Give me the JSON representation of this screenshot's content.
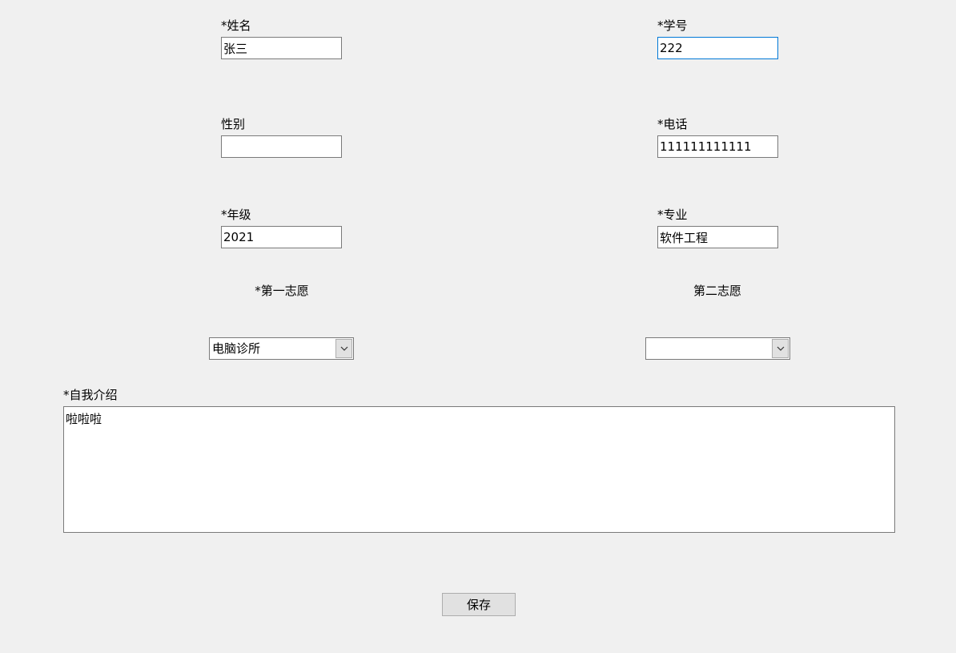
{
  "form": {
    "name": {
      "label": "*姓名",
      "value": "张三"
    },
    "student_id": {
      "label": "*学号",
      "value": "222"
    },
    "gender": {
      "label": "性别",
      "value": ""
    },
    "phone": {
      "label": "*电话",
      "value": "111111111111"
    },
    "grade": {
      "label": "*年级",
      "value": "2021"
    },
    "major": {
      "label": "*专业",
      "value": "软件工程"
    },
    "first_choice": {
      "label": "*第一志愿",
      "value": "电脑诊所"
    },
    "second_choice": {
      "label": "第二志愿",
      "value": ""
    },
    "intro": {
      "label": "*自我介绍",
      "value": "啦啦啦"
    }
  },
  "actions": {
    "save_label": "保存"
  },
  "icons": {
    "combo_dropdown": "chevron-down-icon"
  },
  "colors": {
    "background": "#f0f0f0",
    "border": "#7a7a7a",
    "focus_border": "#0078d7",
    "button_face": "#e1e1e1"
  }
}
